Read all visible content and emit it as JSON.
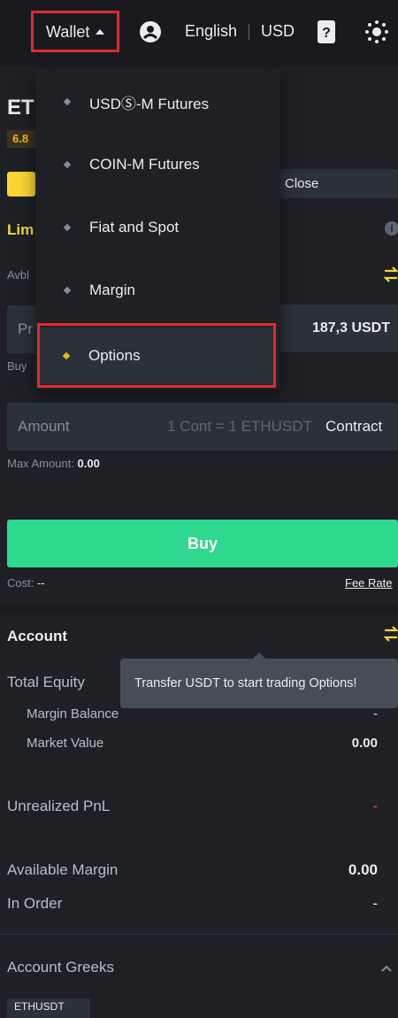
{
  "header": {
    "wallet_label": "Wallet",
    "language": "English",
    "currency": "USD",
    "icons": [
      "caret-up-icon",
      "user-avatar-icon",
      "download-app-icon",
      "settings-icon"
    ]
  },
  "left_fragments": {
    "pair_frag": "ET",
    "pct_frag": "6.8",
    "limit_frag": "Lim",
    "avbl_frag": "Avbl",
    "price_frag": "Pr",
    "buy_frag": "Buy"
  },
  "wallet_menu": {
    "items": [
      {
        "label": "USDⓈ-M Futures"
      },
      {
        "label": "COIN-M Futures"
      },
      {
        "label": "Fiat and Spot"
      },
      {
        "label": "Margin"
      },
      {
        "label": "Options"
      }
    ]
  },
  "order": {
    "close_label": "Close",
    "price_value": "187,3 USDT",
    "amount_placeholder": "Amount",
    "contract_hint": "1 Cont = 1 ETHUSDT",
    "contract_unit": "Contract",
    "max_amount_label": "Max Amount:",
    "max_amount_value": "0.00",
    "buy_button": "Buy",
    "cost_label": "Cost:",
    "cost_value": "--",
    "fee_rate_link": "Fee Rate"
  },
  "account": {
    "title": "Account",
    "tooltip": "Transfer USDT to start trading Options!",
    "total_equity": "Total Equity",
    "margin_balance_label": "Margin Balance",
    "margin_balance_value": "-",
    "market_value_label": "Market Value",
    "market_value_value": "0.00",
    "unrealized_pnl_label": "Unrealized PnL",
    "unrealized_pnl_value": "-",
    "available_margin_label": "Available Margin",
    "available_margin_value": "0.00",
    "in_order_label": "In Order",
    "in_order_value": "-",
    "greeks_label": "Account Greeks",
    "greeks_tag": "ETHUSDT"
  },
  "colors": {
    "accent": "#fcd535",
    "buy": "#0ecb81",
    "highlight": "#e02b2b",
    "sell": "#f6465d"
  }
}
